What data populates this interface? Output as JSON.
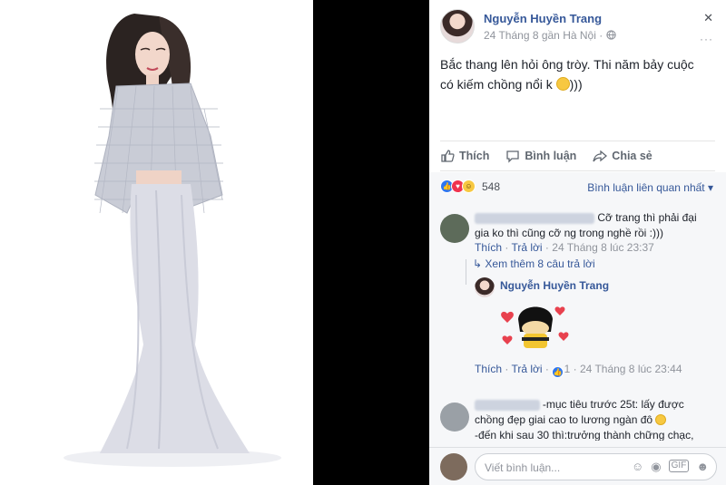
{
  "post": {
    "author": "Nguyễn Huyền Trang",
    "meta": "24 Tháng 8 gần Hà Nội · ",
    "text": "Bắc thang lên hỏi ông tròy. Thi năm bảy cuộc có kiếm chồng nổi k ",
    "text_end": ")))",
    "close": "✕",
    "more": "···"
  },
  "actions": {
    "like": "Thích",
    "comment": "Bình luận",
    "share": "Chia sẻ"
  },
  "feedback": {
    "reaction_count": "548",
    "sort_label": "Bình luận liên quan nhất ▾"
  },
  "comments": [
    {
      "text": "Cỡ trang thì phải đại gia ko thì cũng cỡ ng trong nghề rồi :)))",
      "like": "Thích",
      "reply": "Trả lời",
      "time": "24 Tháng 8 lúc 23:37",
      "more_replies": "Xem thêm 8 câu trả lời",
      "reply_item": {
        "author": "Nguyễn Huyền Trang",
        "like": "Thích",
        "reply": "Trả lời",
        "reacts": "1",
        "time": "24 Tháng 8 lúc 23:44"
      }
    },
    {
      "line1": "-mục tiêu trước 25t: lấy được chồng đẹp giai cao to lương ngàn đô",
      "line2": "-đến khi sau 30 thì:trưởng thành chững chạc,"
    }
  ],
  "input": {
    "placeholder": "Viết bình luận..."
  }
}
